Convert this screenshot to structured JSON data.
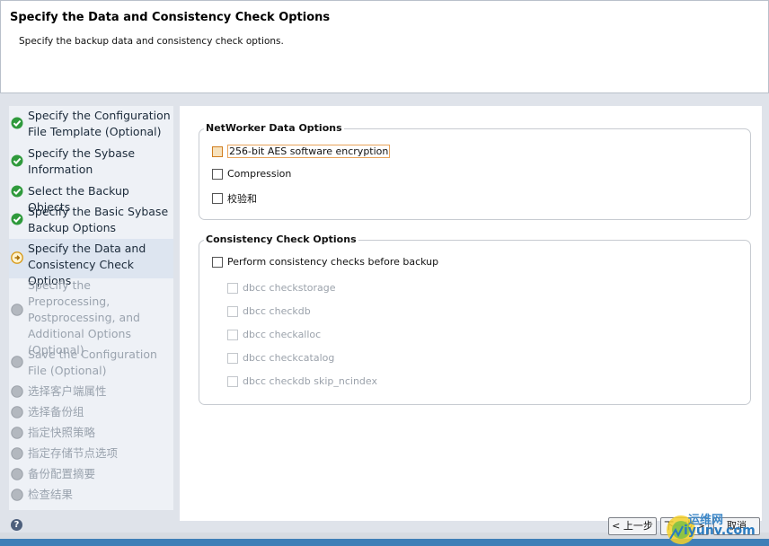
{
  "header": {
    "title": "Specify the Data and Consistency Check Options",
    "subtitle": "Specify the backup data and consistency check options."
  },
  "steps": [
    {
      "label": "Specify the Configuration File Template (Optional)",
      "state": "done"
    },
    {
      "label": "Specify the Sybase Information",
      "state": "done"
    },
    {
      "label": "Select the Backup Objects",
      "state": "done"
    },
    {
      "label": "Specify the Basic Sybase Backup Options",
      "state": "done"
    },
    {
      "label": "Specify the Data and Consistency Check Options",
      "state": "current"
    },
    {
      "label": "Specify the Preprocessing, Postprocessing, and Additional Options (Optional)",
      "state": "pending"
    },
    {
      "label": "Save the Configuration File (Optional)",
      "state": "pending"
    },
    {
      "label": "选择客户端属性",
      "state": "pending"
    },
    {
      "label": "选择备份组",
      "state": "pending"
    },
    {
      "label": "指定快照策略",
      "state": "pending"
    },
    {
      "label": "指定存储节点选项",
      "state": "pending"
    },
    {
      "label": "备份配置摘要",
      "state": "pending"
    },
    {
      "label": "检查结果",
      "state": "pending"
    }
  ],
  "networker": {
    "title": "NetWorker Data Options",
    "aes": "256-bit AES software encryption",
    "compression": "Compression",
    "checksum": "校验和"
  },
  "consistency": {
    "title": "Consistency Check Options",
    "perform": "Perform consistency checks before backup",
    "checkstorage": "dbcc checkstorage",
    "checkdb": "dbcc checkdb",
    "checkalloc": "dbcc checkalloc",
    "checkcatalog": "dbcc checkcatalog",
    "checkdb_skip": "dbcc checkdb skip_ncindex"
  },
  "footer": {
    "help": "?",
    "back": "< 上一步",
    "next": "下一步 >",
    "cancel": "取消"
  },
  "watermark": {
    "line1": "运维网",
    "line2": "iyunv.com"
  },
  "colors": {
    "done": "#2f9a3c",
    "current": "#e0a020",
    "pending": "#a7adb5"
  }
}
